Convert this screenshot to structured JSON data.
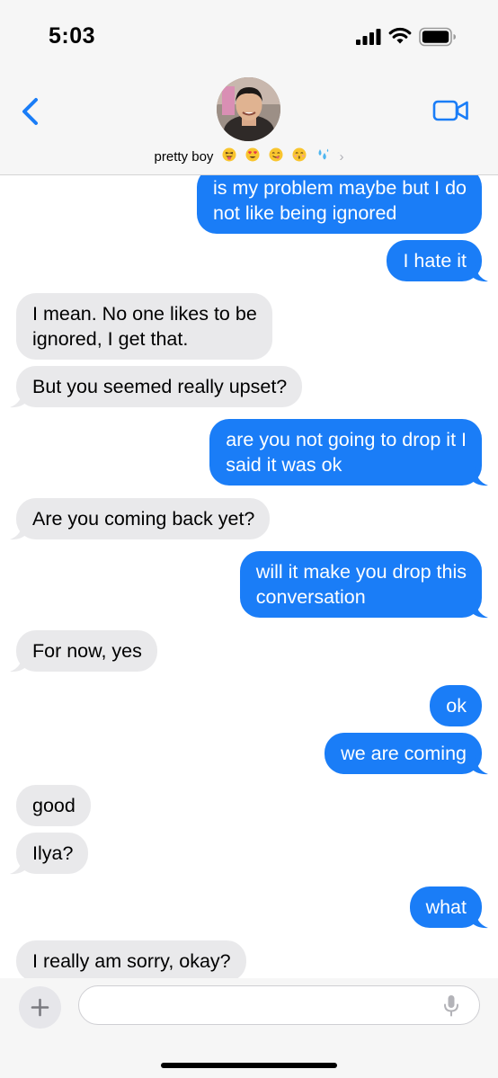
{
  "status_bar": {
    "time": "5:03"
  },
  "header": {
    "contact_name": "pretty boy",
    "name_emojis": [
      "😜",
      "😍",
      "😋",
      "😚",
      "💦"
    ]
  },
  "messages": [
    {
      "from": "me",
      "lines": [
        "is my problem maybe but I do",
        "not like being ignored"
      ]
    },
    {
      "from": "me",
      "lines": [
        "I hate it"
      ]
    },
    {
      "from": "them",
      "lines": [
        "I mean. No one likes to be",
        "ignored, I get that."
      ]
    },
    {
      "from": "them",
      "lines": [
        "But you seemed really upset?"
      ]
    },
    {
      "from": "me",
      "lines": [
        "are you not going to drop it I",
        "said it was ok"
      ]
    },
    {
      "from": "them",
      "lines": [
        "Are you coming back yet?"
      ]
    },
    {
      "from": "me",
      "lines": [
        "will it make you drop this",
        "conversation"
      ]
    },
    {
      "from": "them",
      "lines": [
        "For now, yes"
      ]
    },
    {
      "from": "me",
      "lines": [
        "ok"
      ]
    },
    {
      "from": "me",
      "lines": [
        "we are coming"
      ]
    },
    {
      "from": "them",
      "lines": [
        "good"
      ]
    },
    {
      "from": "them",
      "lines": [
        "Ilya?"
      ]
    },
    {
      "from": "me",
      "lines": [
        "what"
      ]
    },
    {
      "from": "them",
      "lines": [
        "I really am sorry, okay?"
      ]
    }
  ],
  "compose": {
    "placeholder": ""
  },
  "colors": {
    "sent": "#1a7df7",
    "received": "#e9e9eb",
    "accent": "#1a7df7"
  },
  "icons": [
    "back-chevron-icon",
    "facetime-video-icon",
    "plus-icon",
    "microphone-icon",
    "cellular-signal-icon",
    "wifi-icon",
    "battery-icon"
  ]
}
